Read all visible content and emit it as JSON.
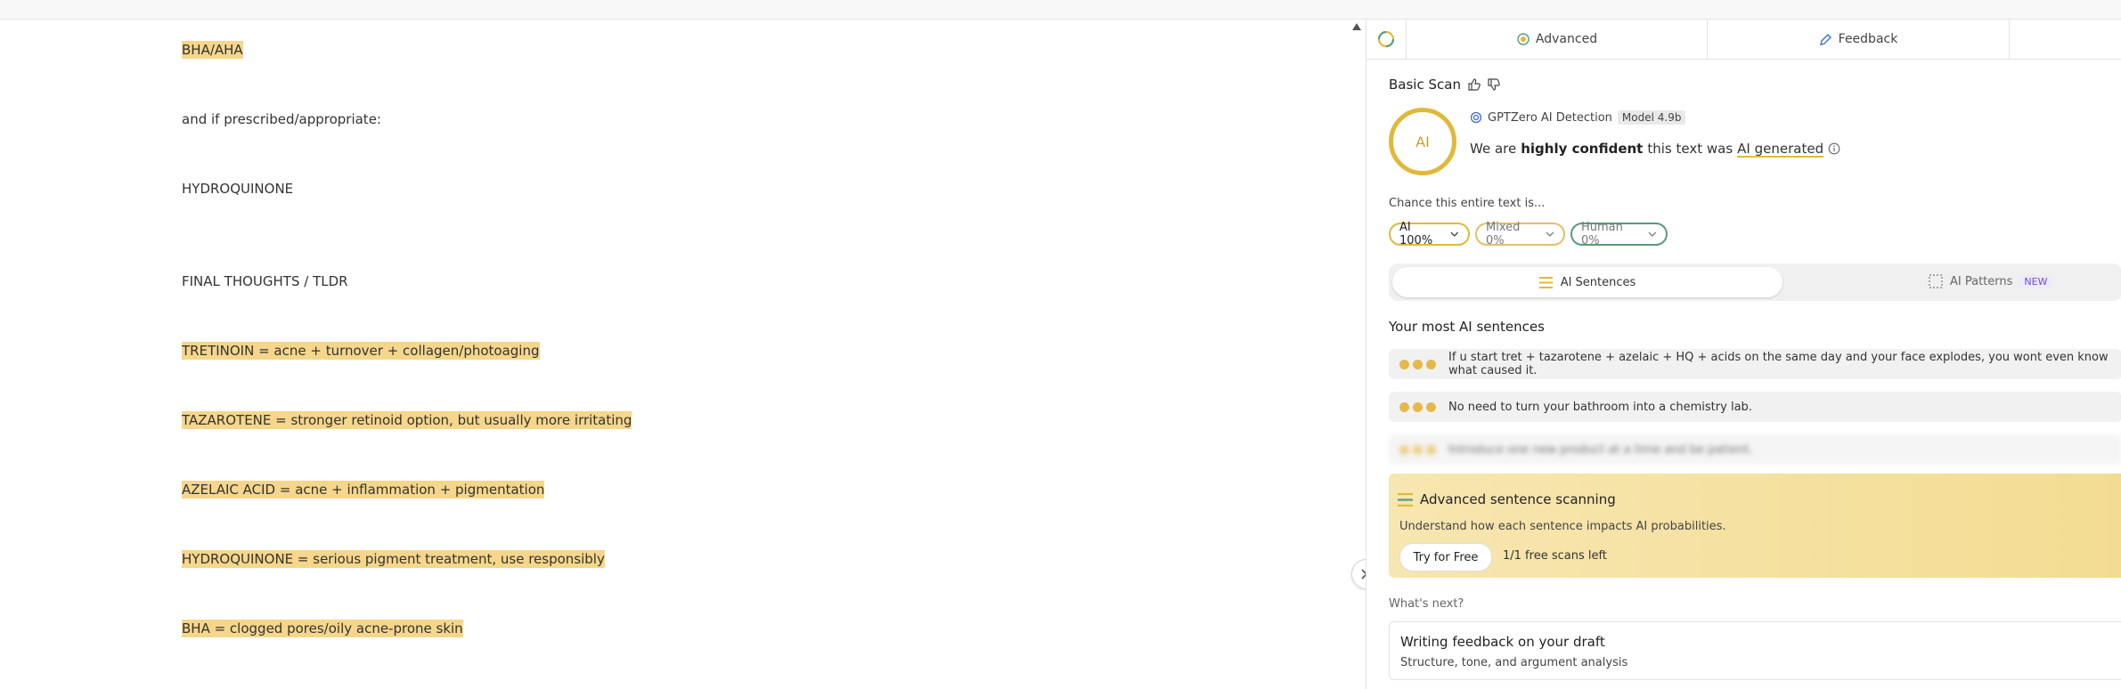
{
  "editor": {
    "lines": [
      {
        "text": "BHA/AHA",
        "highlighted": true
      },
      {
        "text": "and if prescribed/appropriate:",
        "highlighted": false
      },
      {
        "text": "HYDROQUINONE",
        "highlighted": false
      },
      {
        "text": "FINAL THOUGHTS / TLDR",
        "highlighted": false
      },
      {
        "text": "TRETINOIN = acne + turnover + collagen/photoaging",
        "highlighted": true
      },
      {
        "text": "TAZAROTENE = stronger retinoid option, but usually more irritating",
        "highlighted": true
      },
      {
        "text": "AZELAIC ACID = acne + inflammation + pigmentation",
        "highlighted": true
      },
      {
        "text": "HYDROQUINONE = serious pigment treatment, use responsibly",
        "highlighted": true
      },
      {
        "text": "BHA = clogged pores/oily acne-prone skin",
        "highlighted": true
      }
    ]
  },
  "tabs": {
    "advanced": "Advanced",
    "feedback": "Feedback"
  },
  "scan": {
    "title": "Basic Scan",
    "circle_label": "AI",
    "detector": "GPTZero AI Detection",
    "model": "Model 4.9b",
    "confidence_prefix": "We are",
    "confidence_strength": "highly confident",
    "confidence_mid": "this text was",
    "confidence_result": "AI generated"
  },
  "chance": {
    "label": "Chance this entire text is...",
    "ai": "AI 100%",
    "mixed": "Mixed 0%",
    "human": "Human 0%"
  },
  "toggle": {
    "sentences": "AI Sentences",
    "patterns": "AI Patterns",
    "new_badge": "NEW"
  },
  "most_ai": {
    "title": "Your most AI sentences",
    "sentences": [
      "If u start tret + tazarotene + azelaic + HQ + acids on the same day and your face explodes, you wont even know what caused it.",
      "No need to turn your bathroom into a chemistry lab.",
      "Introduce one new product at a time and be patient."
    ]
  },
  "advanced_card": {
    "title": "Advanced sentence scanning",
    "subtitle": "Understand how each sentence impacts AI probabilities.",
    "button": "Try for Free",
    "scans_left": "1/1 free scans left"
  },
  "whats_next": "What's next?",
  "writing_card": {
    "title": "Writing feedback on your draft",
    "subtitle": "Structure, tone, and argument analysis"
  },
  "colors": {
    "highlight": "#f6d68a",
    "ai_yellow": "#e0b93a",
    "human_green": "#5a9a7a"
  }
}
